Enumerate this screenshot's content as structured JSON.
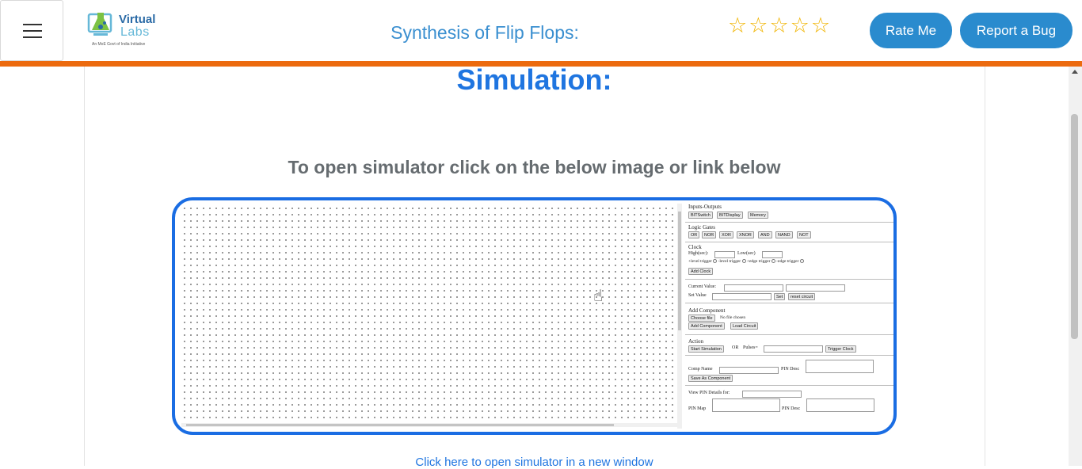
{
  "header": {
    "menu_icon": "hamburger-menu-icon",
    "logo": {
      "top": "Virtual",
      "bottom": "Labs",
      "tagline": "An MoE Govt of India Initiative"
    },
    "title": "Synthesis of Flip Flops:",
    "rating": {
      "stars": 5,
      "filled": 0,
      "icon": "star-outline-icon",
      "color": "#f0b400"
    },
    "rate_button": "Rate Me",
    "bug_button": "Report a Bug",
    "accent_color": "#ec6a0e",
    "button_color": "#2a8bce"
  },
  "main": {
    "heading": "Simulation:",
    "instruction": "To open simulator click on the below image or link below",
    "link": "Click here to open simulator in a new window"
  },
  "simulator": {
    "io": {
      "title": "Inputs-Outputs",
      "buttons": [
        "BITSwitch",
        "BITDisplay",
        "Memory"
      ]
    },
    "gates": {
      "title": "Logic Gates",
      "buttons": [
        "OR",
        "NOR",
        "XOR",
        "XNOR",
        "AND",
        "NAND",
        "NOT"
      ]
    },
    "clock": {
      "title": "Clock",
      "high_label": "High(sec):",
      "low_label": "Low(sec)",
      "triggers": [
        "+level trigger",
        "-level trigger",
        "+edge trigger",
        "-edge trigger"
      ],
      "add_button": "Add Clock"
    },
    "values": {
      "current_label": "Current Value:",
      "set_label": "Set Value",
      "set_button": "Set",
      "reset_button": "reset circuit"
    },
    "component": {
      "title": "Add Component",
      "choose_button": "Choose file",
      "no_file": "No file chosen",
      "add_button": "Add Component",
      "load_button": "Load Circuit"
    },
    "action": {
      "title": "Action",
      "start_button": "Start Simulation",
      "or_label": "OR",
      "pulses_label": "Pulses=",
      "trigger_button": "Trigger Clock"
    },
    "comp": {
      "name_label": "Comp Name",
      "pin_desc_label": "PIN Desc",
      "save_button": "Save As Component"
    },
    "pin": {
      "view_label": "View PIN Details for:",
      "map_label": "PIN Map",
      "desc_label": "PIN Desc"
    }
  }
}
